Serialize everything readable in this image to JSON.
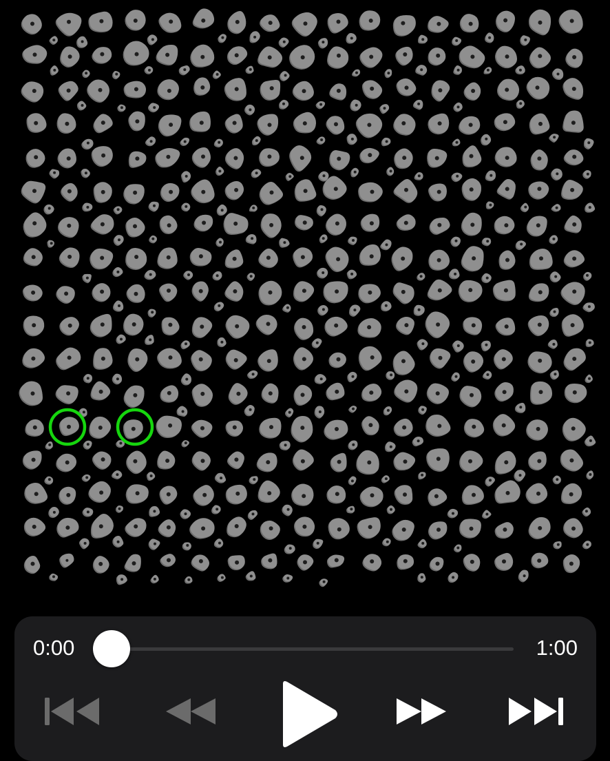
{
  "board": {
    "hold_color": "#8f8f8f",
    "hold_edge_color": "#6d6d6d",
    "bolt_color": "#1e1e1e",
    "selected_ring_color": "#16d60e",
    "selected_hold_count": 2
  },
  "player": {
    "current_time": "0:00",
    "total_time": "1:00",
    "progress": 0.0,
    "disabled_color": "#6b6b6b",
    "enabled_color": "#ffffff",
    "controls": [
      {
        "name": "skip-back",
        "icon": "skip-back-icon",
        "enabled": false
      },
      {
        "name": "rewind",
        "icon": "rewind-icon",
        "enabled": false
      },
      {
        "name": "play",
        "icon": "play-icon",
        "enabled": true
      },
      {
        "name": "fast-forward",
        "icon": "fast-forward-icon",
        "enabled": true
      },
      {
        "name": "skip-forward",
        "icon": "skip-forward-icon",
        "enabled": true
      }
    ]
  }
}
